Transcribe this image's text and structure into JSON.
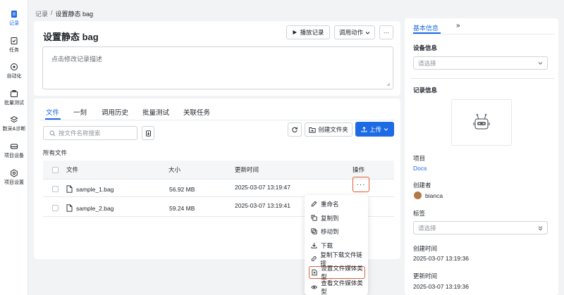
{
  "nav": [
    {
      "label": "记录",
      "icon": "document-icon"
    },
    {
      "label": "任务",
      "icon": "task-icon"
    },
    {
      "label": "自动化",
      "icon": "automation-icon"
    },
    {
      "label": "批量测试",
      "icon": "batch-test-icon"
    },
    {
      "label": "数采&诊断",
      "icon": "diagnosis-icon"
    },
    {
      "label": "项目设备",
      "icon": "device-icon"
    },
    {
      "label": "项目设置",
      "icon": "settings-icon"
    }
  ],
  "breadcrumb": {
    "root": "记录",
    "sep": "/",
    "current": "设置静态 bag"
  },
  "record": {
    "title": "设置静态 bag",
    "play_label": "播放记录",
    "action_label": "调用动作",
    "more_label": "···",
    "desc_placeholder": "点击修改记录描述"
  },
  "tabs": [
    "文件",
    "一刻",
    "调用历史",
    "批量测试",
    "关联任务"
  ],
  "files": {
    "search_placeholder": "按文件名称搜索",
    "create_folder_label": "创建文件夹",
    "upload_label": "上传",
    "section_label": "所有文件",
    "columns": {
      "name": "文件",
      "size": "大小",
      "updated": "更新时间",
      "actions": "操作"
    },
    "rows": [
      {
        "name": "sample_1.bag",
        "size": "56.92 MB",
        "updated": "2025-03-07 13:19:47"
      },
      {
        "name": "sample_2.bag",
        "size": "59.24 MB",
        "updated": "2025-03-07 13:19:41"
      }
    ],
    "row_more": "···"
  },
  "menu": [
    {
      "label": "重命名",
      "icon": "pencil-icon"
    },
    {
      "label": "复制到",
      "icon": "copy-icon"
    },
    {
      "label": "移动到",
      "icon": "move-icon"
    },
    {
      "label": "下载",
      "icon": "download-icon"
    },
    {
      "label": "复制下载文件链接",
      "icon": "link-icon"
    },
    {
      "label": "设置文件媒体类型",
      "icon": "file-type-icon"
    },
    {
      "label": "查看文件媒体类型",
      "icon": "eye-icon"
    }
  ],
  "panel": {
    "tab_basic": "基本信息",
    "tab_expand": "»",
    "device_info": "设备信息",
    "device_placeholder": "请选择",
    "record_info": "记录信息",
    "project_label": "项目",
    "project_value": "Docs",
    "creator_label": "创建者",
    "creator_value": "bianca",
    "tags_label": "标签",
    "tags_placeholder": "请选择",
    "created_label": "创建时间",
    "created_value": "2025-03-07 13:19:36",
    "updated_label": "更新时间",
    "updated_value": "2025-03-07 13:19:36"
  },
  "colors": {
    "accent": "#1d6ae5",
    "highlight": "#e35d3b"
  }
}
